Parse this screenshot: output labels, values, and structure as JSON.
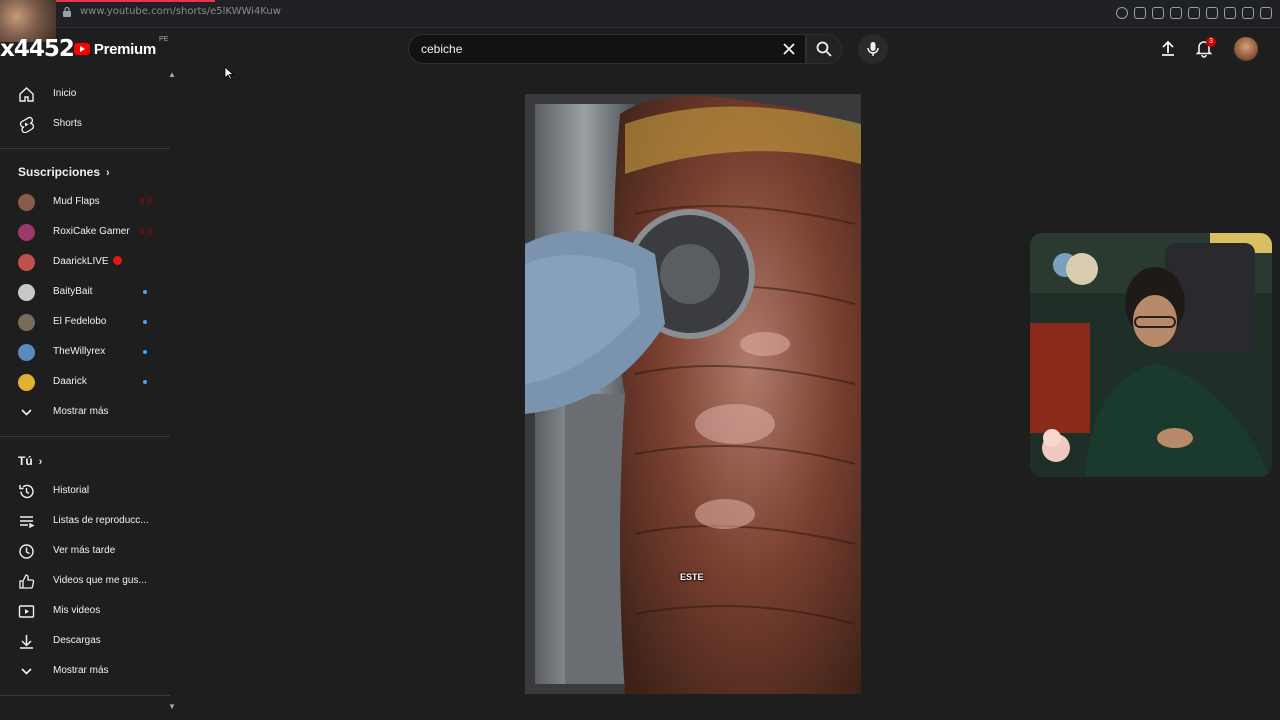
{
  "browser": {
    "url": "www.youtube.com/shorts/e5lKWWi4Kuw"
  },
  "header": {
    "brand_prefix": "x4452",
    "premium_label": "Premium",
    "region": "PE",
    "search_value": "cebiche",
    "notification_count": "3"
  },
  "sidebar": {
    "main": [
      {
        "label": "Inicio",
        "icon": "home-icon"
      },
      {
        "label": "Shorts",
        "icon": "shorts-icon"
      }
    ],
    "subscriptions_title": "Suscripciones",
    "subscriptions": [
      {
        "label": "Mud Flaps",
        "status": "live-badge",
        "avatar_color": "#8a5a4a"
      },
      {
        "label": "RoxiCake Gamer",
        "status": "live-badge",
        "avatar_color": "#9a3a6a"
      },
      {
        "label": "DaarickLIVE",
        "status": "live-dot",
        "avatar_color": "#c0504a"
      },
      {
        "label": "BaityBait",
        "status": "new-dot",
        "avatar_color": "#c8c8c8"
      },
      {
        "label": "El Fedelobo",
        "status": "new-dot",
        "avatar_color": "#7a6a5a"
      },
      {
        "label": "TheWillyrex",
        "status": "new-dot",
        "avatar_color": "#5a8ac0"
      },
      {
        "label": "Daarick",
        "status": "new-dot",
        "avatar_color": "#e0b030"
      }
    ],
    "subscriptions_more": "Mostrar más",
    "you_title": "Tú",
    "you_items": [
      {
        "label": "Historial",
        "icon": "history-icon"
      },
      {
        "label": "Listas de reproducc...",
        "icon": "playlist-icon"
      },
      {
        "label": "Ver más tarde",
        "icon": "clock-icon"
      },
      {
        "label": "Videos que me gus...",
        "icon": "thumbs-up-icon"
      },
      {
        "label": "Mis videos",
        "icon": "video-icon"
      },
      {
        "label": "Descargas",
        "icon": "download-icon"
      }
    ],
    "you_more": "Mostrar más"
  },
  "video": {
    "caption": "ESTE"
  }
}
